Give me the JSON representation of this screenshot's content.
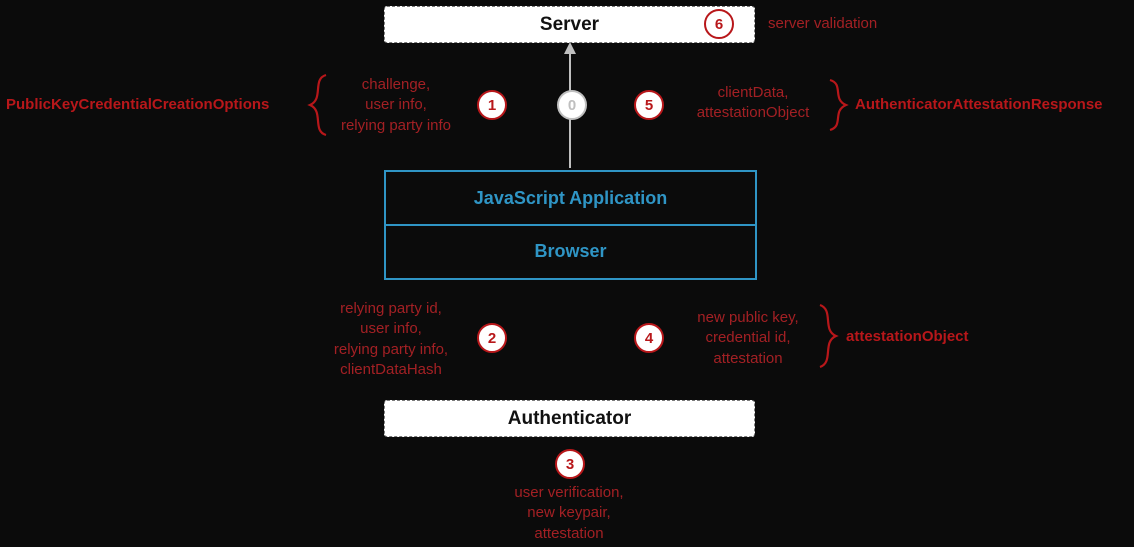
{
  "boxes": {
    "server": "Server",
    "js_app": "JavaScript Application",
    "browser": "Browser",
    "authenticator": "Authenticator"
  },
  "steps": {
    "zero": "0",
    "s1": {
      "num": "1",
      "text": "challenge,\nuser info,\nrelying party info",
      "object": "PublicKeyCredentialCreationOptions"
    },
    "s2": {
      "num": "2",
      "text": "relying party id,\nuser info,\nrelying party info,\nclientDataHash"
    },
    "s3": {
      "num": "3",
      "text": "user verification,\nnew keypair,\nattestation"
    },
    "s4": {
      "num": "4",
      "text": "new public key,\ncredential id,\nattestation",
      "object": "attestationObject"
    },
    "s5": {
      "num": "5",
      "text": "clientData,\nattestationObject",
      "object": "AuthenticatorAttestationResponse"
    },
    "s6": {
      "num": "6",
      "text": "server validation"
    }
  }
}
